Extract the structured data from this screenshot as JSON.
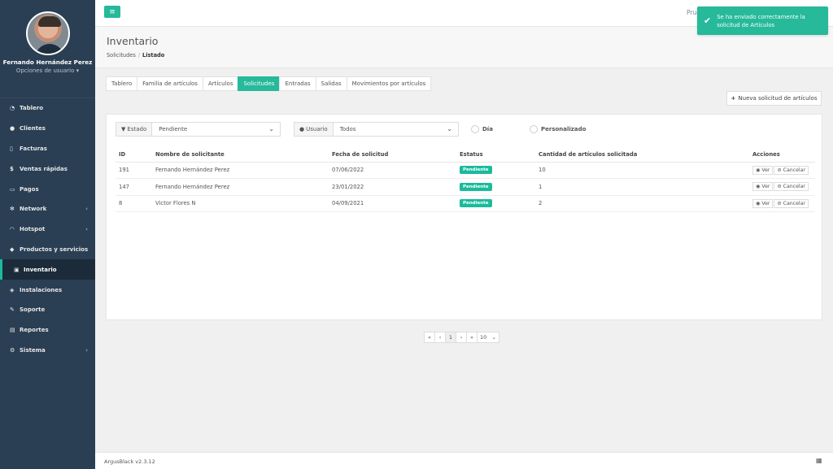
{
  "sidebar": {
    "user_name": "Fernando Hernández Perez",
    "user_options": "Opciones de usuario",
    "items": [
      {
        "label": "Tablero",
        "icon": "dashboard-icon"
      },
      {
        "label": "Clientes",
        "icon": "users-icon"
      },
      {
        "label": "Facturas",
        "icon": "file-icon"
      },
      {
        "label": "Ventas rápidas",
        "icon": "dollar-icon"
      },
      {
        "label": "Pagos",
        "icon": "money-icon"
      },
      {
        "label": "Network",
        "icon": "network-icon"
      },
      {
        "label": "Hotspot",
        "icon": "wifi-icon"
      },
      {
        "label": "Productos y servicios",
        "icon": "tag-icon"
      },
      {
        "label": "Inventario",
        "icon": "cubes-icon"
      },
      {
        "label": "Instalaciones",
        "icon": "tags-icon"
      },
      {
        "label": "Soporte",
        "icon": "wrench-icon"
      },
      {
        "label": "Reportes",
        "icon": "book-icon"
      },
      {
        "label": "Sistema",
        "icon": "cogs-icon"
      }
    ]
  },
  "topbar": {
    "user_label": "Prue"
  },
  "toast": {
    "line1": "Se ha enviado correctamente la",
    "line2": "solicitud de Artículos"
  },
  "header": {
    "title": "Inventario",
    "crumb_parent": "Solicitudes",
    "crumb_current": "Listado"
  },
  "tabs": [
    "Tablero",
    "Familia de artículos",
    "Artículos",
    "Solicitudes",
    "Entradas",
    "Salidas",
    "Movimientos por artículos"
  ],
  "new_button": "Nueva solicitud de artículos",
  "filters": {
    "estado_label": "Estado",
    "estado_value": "Pendiente",
    "usuario_label": "Usuario",
    "usuario_value": "Todos",
    "radio_dia": "Día",
    "radio_personalizado": "Personalizado"
  },
  "table": {
    "headers": [
      "ID",
      "Nombre de solicitante",
      "Fecha de solicitud",
      "Estatus",
      "Cantidad de artículos solicitada",
      "Acciones"
    ],
    "rows": [
      [
        "191",
        "Fernando Hernández Perez",
        "07/06/2022",
        "Pendiente",
        "10"
      ],
      [
        "147",
        "Fernando Hernández Perez",
        "23/01/2022",
        "Pendiente",
        "1"
      ],
      [
        "8",
        "Victor Flores N",
        "04/09/2021",
        "Pendiente",
        "2"
      ]
    ],
    "view_label": "Ver",
    "cancel_label": "Cancelar"
  },
  "pager": {
    "first": "«",
    "prev": "‹",
    "page": "1",
    "next": "›",
    "last": "»",
    "page_size": "10"
  },
  "footer": {
    "version": "ArgusBlack v2.3.12"
  }
}
